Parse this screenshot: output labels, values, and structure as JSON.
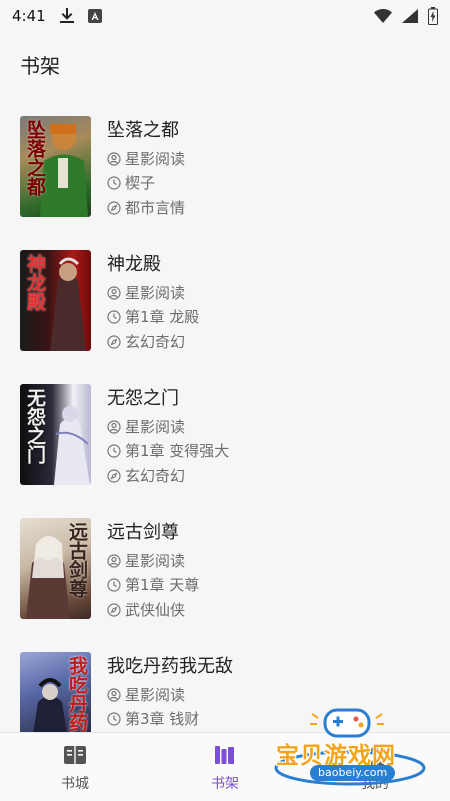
{
  "status_bar": {
    "time": "4:41",
    "icons": [
      "download-icon",
      "a-badge-icon",
      "wifi-icon",
      "signal-icon",
      "battery-icon"
    ]
  },
  "page_title": "书架",
  "books": [
    {
      "title": "坠落之都",
      "source": "星影阅读",
      "progress": "楔子",
      "category": "都市言情",
      "cover_text": "坠落之都",
      "cover_colors": [
        "#6b6b6b",
        "#2e6a2b"
      ]
    },
    {
      "title": "神龙殿",
      "source": "星影阅读",
      "progress": "第1章 龙殿",
      "category": "玄幻奇幻",
      "cover_text": "神龙殿",
      "cover_colors": [
        "#1a1a1a",
        "#b01818"
      ]
    },
    {
      "title": "无怨之门",
      "source": "星影阅读",
      "progress": "第1章 变得强大",
      "category": "玄幻奇幻",
      "cover_text": "无怨之门",
      "cover_colors": [
        "#f2f2f2",
        "#3c3c6a"
      ]
    },
    {
      "title": "远古剑尊",
      "source": "星影阅读",
      "progress": "第1章 天尊",
      "category": "武侠仙侠",
      "cover_text": "远古剑尊",
      "cover_colors": [
        "#d9d2c7",
        "#6a4a3a"
      ]
    },
    {
      "title": "我吃丹药我无敌",
      "source": "星影阅读",
      "progress": "第3章 钱财",
      "category": "",
      "cover_text": "我吃丹药",
      "cover_colors": [
        "#5a6aa8",
        "#2c2f4a"
      ]
    }
  ],
  "tabs": [
    {
      "label": "书城",
      "icon": "book-open-icon"
    },
    {
      "label": "书架",
      "icon": "bookshelf-icon",
      "active": true
    },
    {
      "label": "我的",
      "icon": "profile-icon"
    }
  ],
  "watermark": {
    "title": "宝贝游戏网",
    "url": "baobeiy.com"
  },
  "colors": {
    "accent": "#7b4fd6",
    "background": "#f6f6f6",
    "meta_text": "#6d6d6d"
  }
}
